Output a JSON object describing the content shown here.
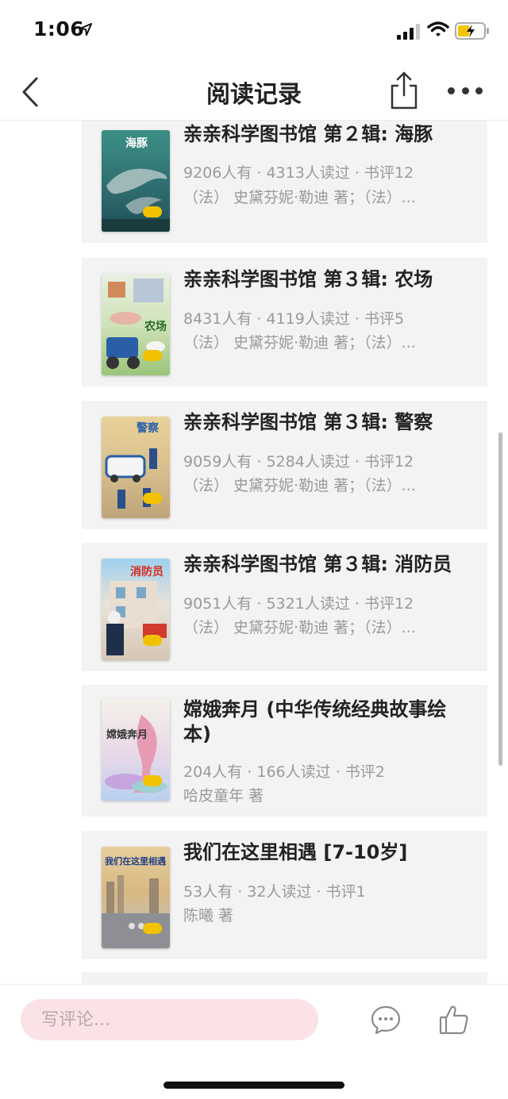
{
  "status_bar": {
    "time": "1:06"
  },
  "header": {
    "title": "阅读记录"
  },
  "books": [
    {
      "title": "亲亲科学图书馆 第２辑: 海豚",
      "stats": "9206人有 · 4313人读过 · 书评12",
      "author": "（法） 史黛芬妮·勒迪 著；（法）...",
      "cover_text": "海豚"
    },
    {
      "title": "亲亲科学图书馆 第３辑: 农场",
      "stats": "8431人有 · 4119人读过 · 书评5",
      "author": "（法） 史黛芬妮·勒迪 著；（法）...",
      "cover_text": "农场"
    },
    {
      "title": "亲亲科学图书馆 第３辑: 警察",
      "stats": "9059人有 · 5284人读过 · 书评12",
      "author": "（法） 史黛芬妮·勒迪 著；（法）...",
      "cover_text": "警察"
    },
    {
      "title": "亲亲科学图书馆 第３辑: 消防员",
      "stats": "9051人有 · 5321人读过 · 书评12",
      "author": "（法） 史黛芬妮·勒迪 著；（法）...",
      "cover_text": "消防员"
    },
    {
      "title": "嫦娥奔月 (中华传统经典故事绘本)",
      "stats": "204人有 · 166人读过 · 书评2",
      "author": "哈皮童年 著",
      "cover_text": "嫦娥奔月"
    },
    {
      "title": "我们在这里相遇 [7-10岁]",
      "stats": "53人有 · 32人读过 · 书评1",
      "author": "陈曦 著",
      "cover_text": "我们在这里相遇"
    }
  ],
  "bottom_bar": {
    "comment_placeholder": "写评论..."
  }
}
